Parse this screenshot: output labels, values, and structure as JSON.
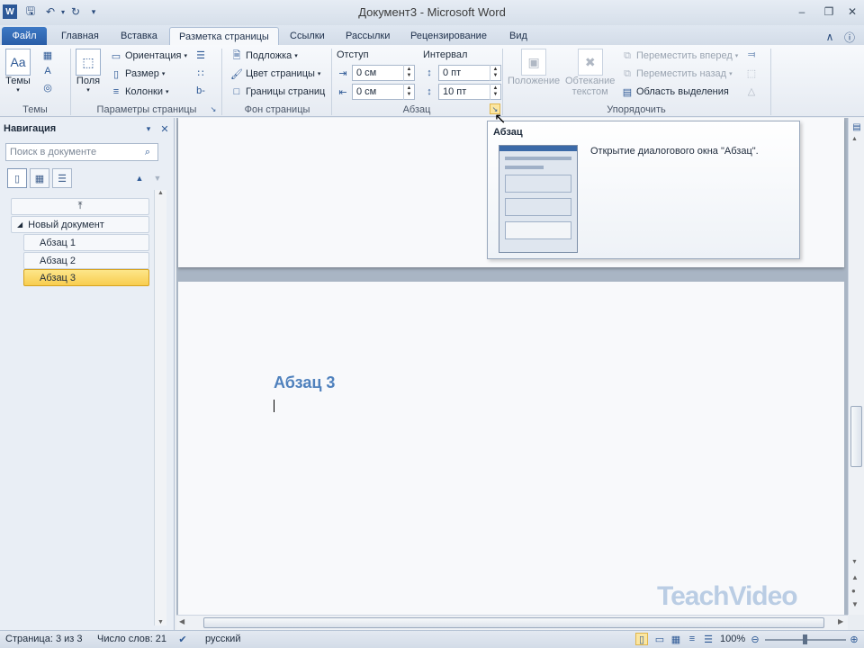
{
  "window": {
    "title": "Документ3  -  Microsoft Word",
    "qat_icons": [
      "word-icon",
      "save-icon",
      "undo-icon",
      "redo-icon",
      "customize-icon"
    ]
  },
  "tabs": [
    {
      "label": "Файл"
    },
    {
      "label": "Главная"
    },
    {
      "label": "Вставка"
    },
    {
      "label": "Разметка страницы"
    },
    {
      "label": "Ссылки"
    },
    {
      "label": "Рассылки"
    },
    {
      "label": "Рецензирование"
    },
    {
      "label": "Вид"
    }
  ],
  "ribbon": {
    "themes": {
      "label": "Темы",
      "group": "Темы"
    },
    "page_setup": {
      "group": "Параметры страницы",
      "margins": "Поля",
      "orientation": "Ориентация",
      "size": "Размер",
      "columns": "Колонки"
    },
    "page_background": {
      "group": "Фон страницы",
      "watermark": "Подложка",
      "page_color": "Цвет страницы",
      "page_borders": "Границы страниц"
    },
    "paragraph": {
      "group": "Абзац",
      "indent_label": "Отступ",
      "spacing_label": "Интервал",
      "indent_left": "0 см",
      "indent_right": "0 см",
      "spacing_before": "0 пт",
      "spacing_after": "10 пт"
    },
    "arrange": {
      "group": "Упорядочить",
      "position": "Положение",
      "wrap_text_1": "Обтекание",
      "wrap_text_2": "текстом",
      "bring_forward": "Переместить вперед",
      "send_backward": "Переместить назад",
      "selection_pane": "Область выделения"
    }
  },
  "tooltip": {
    "title": "Абзац",
    "description": "Открытие диалогового окна \"Абзац\"."
  },
  "navigation": {
    "title": "Навигация",
    "search_placeholder": "Поиск в документе",
    "root": "Новый документ",
    "items": [
      {
        "label": "Абзац 1"
      },
      {
        "label": "Абзац 2"
      },
      {
        "label": "Абзац 3"
      }
    ]
  },
  "document": {
    "heading": "Абзац 3"
  },
  "status": {
    "page": "Страница: 3 из 3",
    "words": "Число слов: 21",
    "language": "русский",
    "zoom": "100%"
  },
  "watermark": "TeachVideo",
  "colors": {
    "accent": "#2a5ea8",
    "heading": "#4f81bd",
    "selected_item": "#f8cd4f"
  }
}
